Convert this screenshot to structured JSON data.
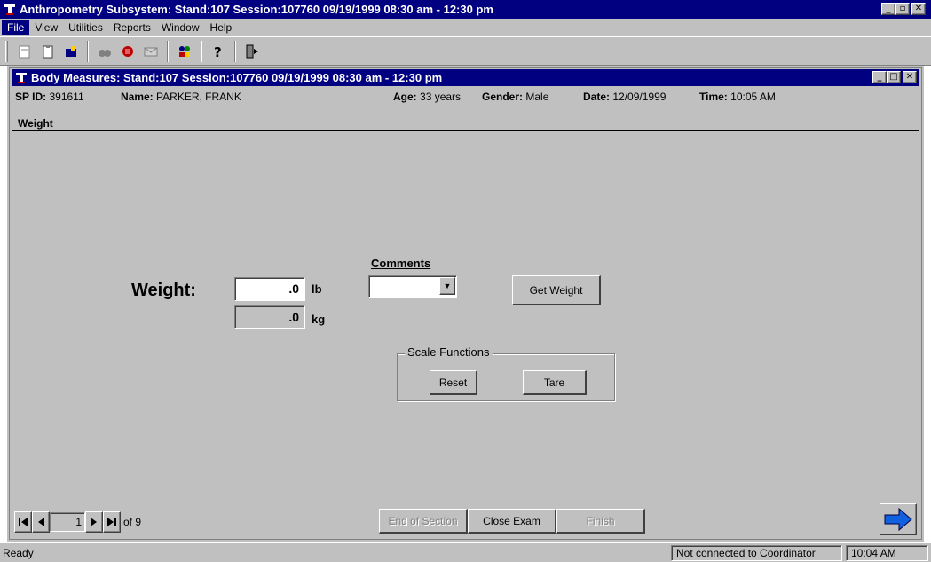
{
  "app": {
    "title": "Anthropometry Subsystem: Stand:107 Session:107760 09/19/1999 08:30 am - 12:30 pm"
  },
  "menu": [
    "File",
    "View",
    "Utilities",
    "Reports",
    "Window",
    "Help"
  ],
  "toolbar_icons": [
    "new-doc-icon",
    "clipboard-icon",
    "open-icon",
    "binoculars-icon",
    "stop-hand-icon",
    "mail-icon",
    "people-icon",
    "help-icon",
    "exit-icon"
  ],
  "child": {
    "title": "Body Measures: Stand:107 Session:107760 09/19/1999 08:30 am - 12:30 pm"
  },
  "patient": {
    "sp_id_label": "SP ID:",
    "sp_id": "391611",
    "name_label": "Name:",
    "name": "PARKER, FRANK",
    "age_label": "Age:",
    "age": "33 years",
    "gender_label": "Gender:",
    "gender": "Male",
    "date_label": "Date:",
    "date": "12/09/1999",
    "time_label": "Time:",
    "time": "10:05 AM"
  },
  "section": {
    "title": "Weight"
  },
  "form": {
    "weight_label": "Weight:",
    "lb_value": ".0",
    "lb_unit": "lb",
    "kg_value": ".0",
    "kg_unit": "kg",
    "comments_label": "Comments",
    "comments_value": "",
    "get_weight_label": "Get Weight",
    "scale_functions_label": "Scale Functions",
    "reset_label": "Reset",
    "tare_label": "Tare"
  },
  "navigator": {
    "current": "1",
    "of_text": "of 9"
  },
  "buttons": {
    "end_of_section": "End of Section",
    "close_exam": "Close Exam",
    "finish": "Finish"
  },
  "status": {
    "text": "Ready",
    "connection": "Not connected to Coordinator",
    "clock": "10:04 AM"
  },
  "colors": {
    "title_bar": "#000080",
    "face": "#c0c0c0"
  }
}
